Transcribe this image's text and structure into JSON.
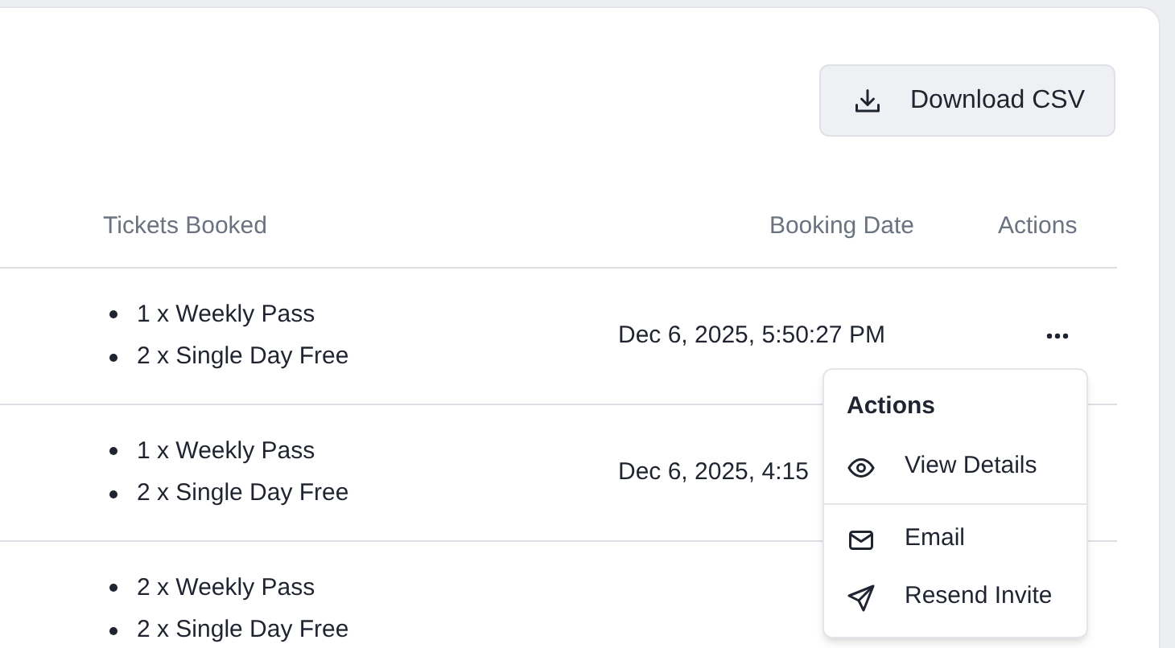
{
  "toolbar": {
    "download_button": "Download CSV"
  },
  "table": {
    "columns": [
      "Tickets Booked",
      "Booking Date",
      "Actions"
    ],
    "rows": [
      {
        "tickets": [
          "1 x Weekly Pass",
          "2 x Single Day Free"
        ],
        "booking_date": "Dec 6, 2025, 5:50:27 PM",
        "has_actions": true
      },
      {
        "tickets": [
          "1 x Weekly Pass",
          "2 x Single Day Free"
        ],
        "booking_date": "Dec 6, 2025, 4:15",
        "has_actions": false
      },
      {
        "tickets": [
          "2 x Weekly Pass",
          "2 x Single Day Free"
        ],
        "has_actions": false
      }
    ]
  },
  "actions_menu": {
    "title": "Actions",
    "groups": [
      [
        {
          "kind": "view",
          "label": "View Details"
        }
      ],
      [
        {
          "kind": "email",
          "label": "Email"
        },
        {
          "kind": "send",
          "label": "Resend Invite"
        }
      ]
    ]
  }
}
